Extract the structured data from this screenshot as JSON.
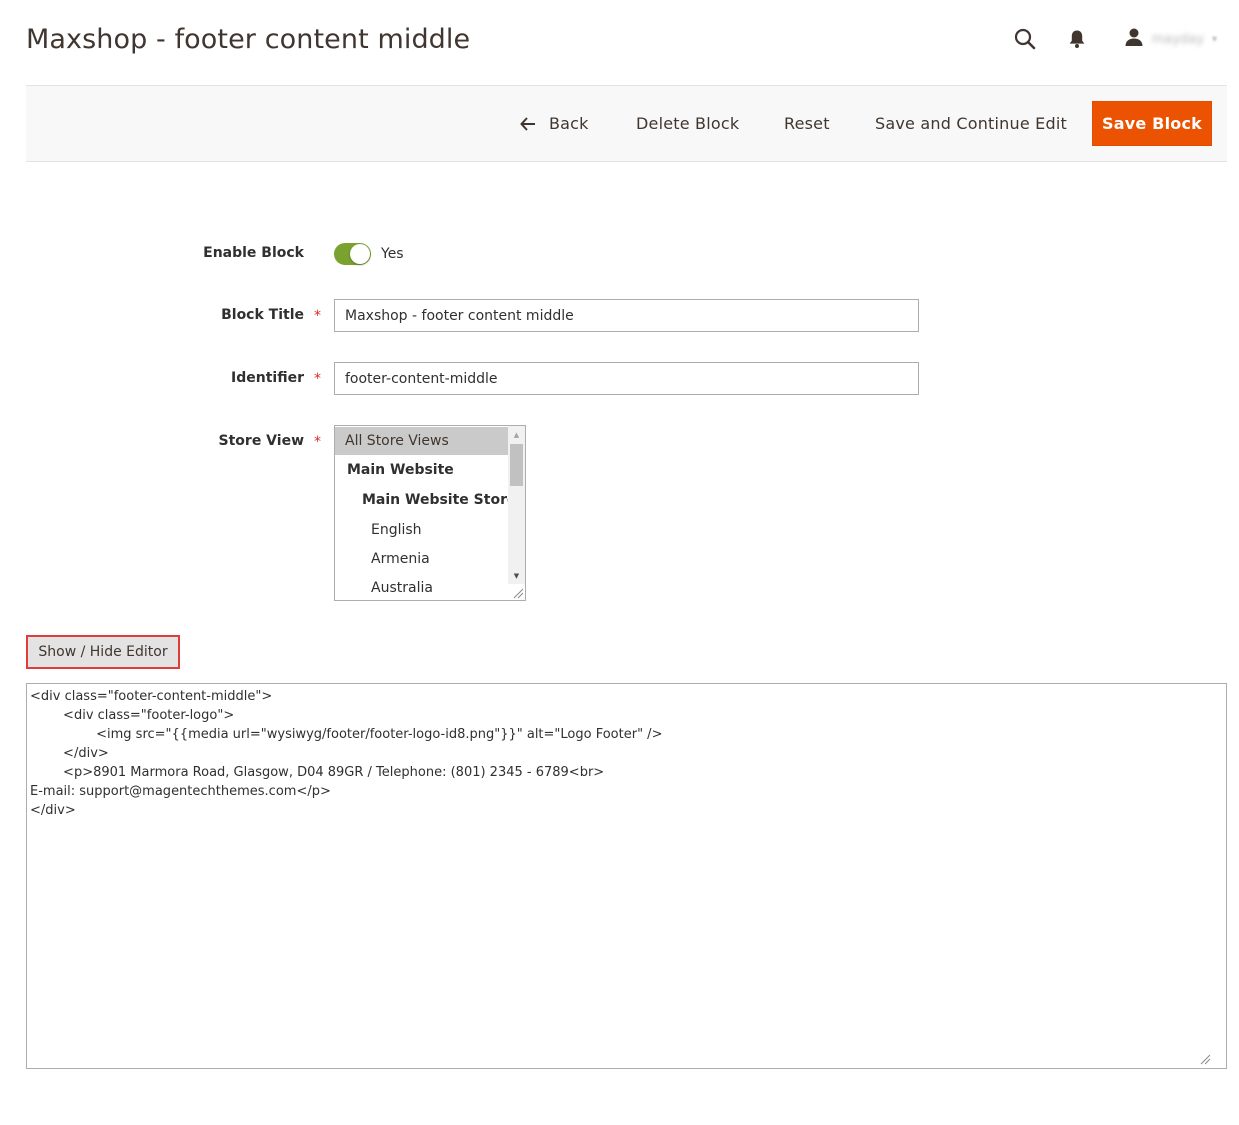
{
  "page": {
    "title": "Maxshop - footer content middle"
  },
  "header": {
    "icons": [
      "search-icon",
      "bell-icon",
      "user-icon"
    ],
    "user_name": "mayday",
    "user_caret": "▾"
  },
  "actions": {
    "back_label": "Back",
    "delete_label": "Delete Block",
    "reset_label": "Reset",
    "save_continue_label": "Save and Continue Edit",
    "save_label": "Save Block"
  },
  "form": {
    "enable_block": {
      "label": "Enable Block",
      "value_text": "Yes",
      "enabled": true
    },
    "block_title": {
      "label": "Block Title",
      "required_mark": "*",
      "value": "Maxshop - footer content middle"
    },
    "identifier": {
      "label": "Identifier",
      "required_mark": "*",
      "value": "footer-content-middle"
    },
    "store_view": {
      "label": "Store View",
      "required_mark": "*",
      "selected": "All Store Views",
      "options": [
        {
          "label": "All Store Views"
        },
        {
          "label": "Main Website"
        },
        {
          "label": "Main Website Store"
        },
        {
          "label": "English"
        },
        {
          "label": "Armenia"
        },
        {
          "label": "Australia"
        }
      ]
    }
  },
  "editor": {
    "toggle_label": "Show / Hide Editor",
    "content": "<div class=\"footer-content-middle\">\n        <div class=\"footer-logo\">\n                <img src=\"{{media url=\"wysiwyg/footer/footer-logo-id8.png\"}}\" alt=\"Logo Footer\" />\n        </div>\n        <p>8901 Marmora Road, Glasgow, D04 89GR / Telephone: (801) 2345 - 6789<br>\nE-mail: support@magentechthemes.com</p>\n</div>"
  },
  "colors": {
    "primary_button": "#eb5202",
    "toggle_on": "#79a22e",
    "required": "#e22626",
    "highlight_border": "#e03c3c"
  }
}
